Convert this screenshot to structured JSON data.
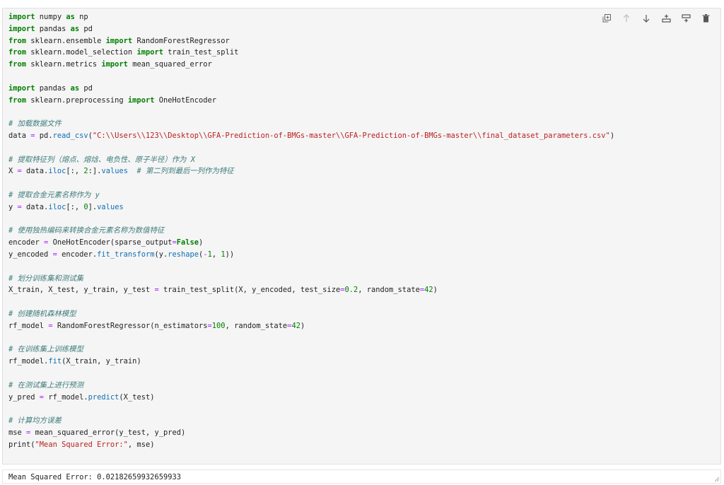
{
  "code_cell": {
    "lines": [
      "import numpy as np",
      "import pandas as pd",
      "from sklearn.ensemble import RandomForestRegressor",
      "from sklearn.model_selection import train_test_split",
      "from sklearn.metrics import mean_squared_error",
      "",
      "import pandas as pd",
      "from sklearn.preprocessing import OneHotEncoder",
      "",
      "# 加载数据文件",
      "data = pd.read_csv(\"C:\\\\Users\\\\123\\\\Desktop\\\\GFA-Prediction-of-BMGs-master\\\\GFA-Prediction-of-BMGs-master\\\\final_dataset_parameters.csv\")",
      "",
      "# 提取特征列（熔点、熔焓、电负性、原子半径）作为 X",
      "X = data.iloc[:, 2:].values  # 第二列到最后一列作为特征",
      "",
      "# 提取合金元素名称作为 y",
      "y = data.iloc[:, 0].values",
      "",
      "# 使用独热编码来转换合金元素名称为数值特征",
      "encoder = OneHotEncoder(sparse_output=False)",
      "y_encoded = encoder.fit_transform(y.reshape(-1, 1))",
      "",
      "# 划分训练集和测试集",
      "X_train, X_test, y_train, y_test = train_test_split(X, y_encoded, test_size=0.2, random_state=42)",
      "",
      "# 创建随机森林模型",
      "rf_model = RandomForestRegressor(n_estimators=100, random_state=42)",
      "",
      "# 在训练集上训练模型",
      "rf_model.fit(X_train, y_train)",
      "",
      "# 在测试集上进行预测",
      "y_pred = rf_model.predict(X_test)",
      "",
      "# 计算均方误差",
      "mse = mean_squared_error(y_test, y_pred)",
      "print(\"Mean Squared Error:\", mse)"
    ]
  },
  "toolbar": {
    "icons": [
      "duplicate-cell-icon",
      "move-up-icon",
      "move-down-icon",
      "insert-above-icon",
      "insert-below-icon",
      "delete-icon"
    ]
  },
  "output": {
    "text": "Mean Squared Error: 0.02182659932659933"
  }
}
